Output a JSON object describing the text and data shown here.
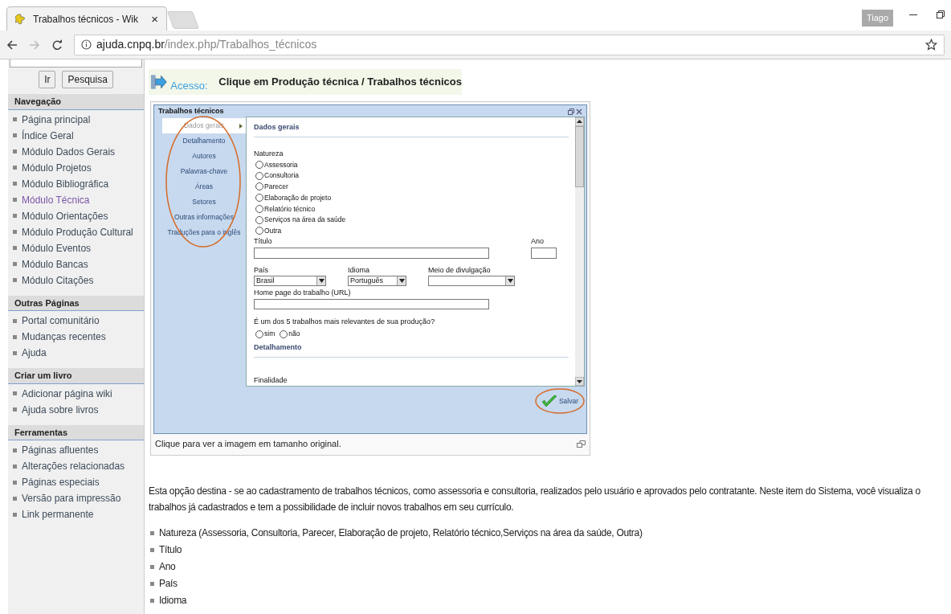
{
  "browser": {
    "tab_title": "Trabalhos técnicos - Wik",
    "tab_close": "×",
    "url_host": "ajuda.cnpq.br",
    "url_path": "/index.php/Trabalhos_técnicos",
    "profile": "Tiago"
  },
  "sidebar": {
    "buttons": [
      "Ir",
      "Pesquisa"
    ],
    "sections": [
      {
        "title": "Navegação",
        "items": [
          {
            "label": "Página principal",
            "visited": false
          },
          {
            "label": "Índice Geral",
            "visited": false
          },
          {
            "label": "Módulo Dados Gerais",
            "visited": false
          },
          {
            "label": "Módulo Projetos",
            "visited": false
          },
          {
            "label": "Módulo Bibliográfica",
            "visited": false
          },
          {
            "label": "Módulo Técnica",
            "visited": true
          },
          {
            "label": "Módulo Orientações",
            "visited": false
          },
          {
            "label": "Módulo Produção Cultural",
            "visited": false
          },
          {
            "label": "Módulo Eventos",
            "visited": false
          },
          {
            "label": "Módulo Bancas",
            "visited": false
          },
          {
            "label": "Módulo Citações",
            "visited": false
          }
        ]
      },
      {
        "title": "Outras Páginas",
        "items": [
          {
            "label": "Portal comunitário",
            "visited": false
          },
          {
            "label": "Mudanças recentes",
            "visited": false
          },
          {
            "label": "Ajuda",
            "visited": false
          }
        ]
      },
      {
        "title": "Criar um livro",
        "items": [
          {
            "label": "Adicionar página wiki",
            "visited": false
          },
          {
            "label": "Ajuda sobre livros",
            "visited": false
          }
        ]
      },
      {
        "title": "Ferramentas",
        "items": [
          {
            "label": "Páginas afluentes",
            "visited": false
          },
          {
            "label": "Alterações relacionadas",
            "visited": false
          },
          {
            "label": "Páginas especiais",
            "visited": false
          },
          {
            "label": "Versão para impressão",
            "visited": false
          },
          {
            "label": "Link permanente",
            "visited": false
          }
        ]
      }
    ]
  },
  "access": {
    "label": "Acesso:",
    "text": "Clique em Produção técnica / Trabalhos técnicos"
  },
  "figure": {
    "dialog_title": "Trabalhos técnicos",
    "nav": [
      {
        "label": "Dados gerais",
        "selected": true
      },
      {
        "label": "Detalhamento",
        "selected": false
      },
      {
        "label": "Autores",
        "selected": false
      },
      {
        "label": "Palavras-chave",
        "selected": false
      },
      {
        "label": "Áreas",
        "selected": false
      },
      {
        "label": "Setores",
        "selected": false
      },
      {
        "label": "Outras informações",
        "selected": false
      },
      {
        "label": "Traduções para o inglês",
        "selected": false
      }
    ],
    "section_title": "Dados gerais",
    "natureza_label": "Natureza",
    "natureza_options": [
      {
        "label": "Assessoria",
        "selected": false
      },
      {
        "label": "Consultoria",
        "selected": false
      },
      {
        "label": "Parecer",
        "selected": false
      },
      {
        "label": "Elaboração de projeto",
        "selected": false
      },
      {
        "label": "Relatório técnico",
        "selected": false
      },
      {
        "label": "Serviços na área da saúde",
        "selected": false
      },
      {
        "label": "Outra",
        "selected": false
      }
    ],
    "titulo_label": "Título",
    "ano_label": "Ano",
    "selects": [
      {
        "label": "País",
        "value": "Brasil"
      },
      {
        "label": "Idioma",
        "value": "Português"
      },
      {
        "label": "Meio de divulgação"
      }
    ],
    "url_label": "Home page do trabalho (URL)",
    "question": "É um dos 5 trabalhos mais relevantes de sua produção?",
    "answers": [
      {
        "label": "sim",
        "selected": false
      },
      {
        "label": "não",
        "selected": false
      }
    ],
    "section2_title": "Detalhamento",
    "finalidade_label": "Finalidade",
    "save": "Salvar",
    "caption": "Clique para ver a imagem em tamanho original."
  },
  "body": {
    "paragraph_lines": [
      "Esta opção destina - se ao cadastramento de trabalhos técnicos, como assessoria e consultoria, realizados pelo usuário e aprovados pelo contratante. Neste item do Sistema, você visualiza o",
      "trabalhos já cadastrados e tem a possibilidade de incluir novos trabalhos em seu currículo."
    ],
    "list": [
      "Natureza (Assessoria, Consultoria, Parecer, Elaboração de projeto, Relatório técnico,Serviços na área da saúde, Outra)",
      "Título",
      "Ano",
      "País",
      "Idioma"
    ]
  }
}
